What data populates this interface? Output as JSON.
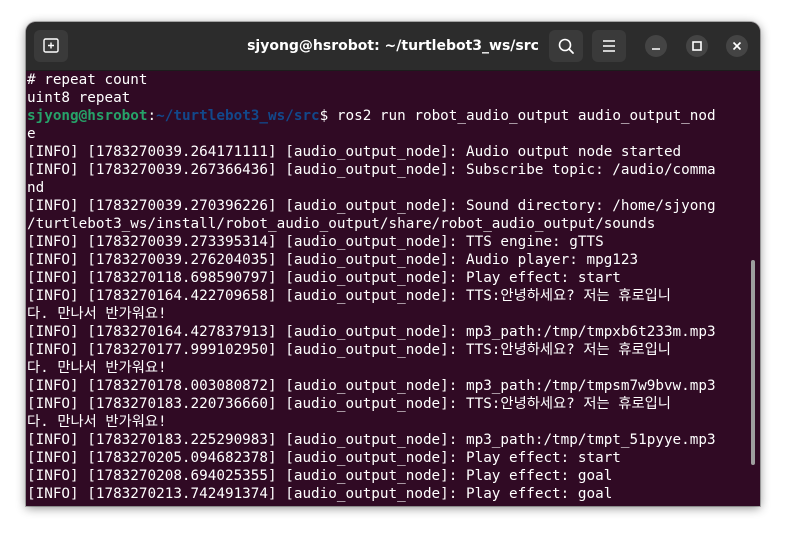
{
  "window": {
    "title": "sjyong@hsrobot: ~/turtlebot3_ws/src"
  },
  "icons": {
    "new_tab": "new-tab-icon",
    "search": "search-icon",
    "menu": "hamburger-menu-icon",
    "minimize": "minimize-icon",
    "maximize": "maximize-icon",
    "close": "close-icon"
  },
  "colors": {
    "terminal_bg": "#300a24",
    "titlebar_bg": "#2c2c2c",
    "prompt_user": "#26a269",
    "prompt_path": "#12488b",
    "text": "#ffffff"
  },
  "terminal": {
    "lines": [
      {
        "text": "# repeat count"
      },
      {
        "text": "uint8 repeat"
      },
      {
        "prompt_user": "sjyong@hsrobot",
        "prompt_colon": ":",
        "prompt_path": "~/turtlebot3_ws/src",
        "text": "$ ros2 run robot_audio_output audio_output_nod"
      },
      {
        "text": "e"
      },
      {
        "text": "[INFO] [1783270039.264171111] [audio_output_node]: Audio output node started"
      },
      {
        "text": "[INFO] [1783270039.267366436] [audio_output_node]: Subscribe topic: /audio/comma"
      },
      {
        "text": "nd"
      },
      {
        "text": "[INFO] [1783270039.270396226] [audio_output_node]: Sound directory: /home/sjyong"
      },
      {
        "text": "/turtlebot3_ws/install/robot_audio_output/share/robot_audio_output/sounds"
      },
      {
        "text": "[INFO] [1783270039.273395314] [audio_output_node]: TTS engine: gTTS"
      },
      {
        "text": "[INFO] [1783270039.276204035] [audio_output_node]: Audio player: mpg123"
      },
      {
        "text": "[INFO] [1783270118.698590797] [audio_output_node]: Play effect: start"
      },
      {
        "text": "[INFO] [1783270164.422709658] [audio_output_node]: TTS:안녕하세요? 저는 휴로입니"
      },
      {
        "text": "다. 만나서 반가워요!"
      },
      {
        "text": "[INFO] [1783270164.427837913] [audio_output_node]: mp3_path:/tmp/tmpxb6t233m.mp3"
      },
      {
        "text": "[INFO] [1783270177.999102950] [audio_output_node]: TTS:안녕하세요? 저는 휴로입니"
      },
      {
        "text": "다. 만나서 반가워요!"
      },
      {
        "text": "[INFO] [1783270178.003080872] [audio_output_node]: mp3_path:/tmp/tmpsm7w9bvw.mp3"
      },
      {
        "text": "[INFO] [1783270183.220736660] [audio_output_node]: TTS:안녕하세요? 저는 휴로입니"
      },
      {
        "text": "다. 만나서 반가워요!"
      },
      {
        "text": "[INFO] [1783270183.225290983] [audio_output_node]: mp3_path:/tmp/tmpt_51pyye.mp3"
      },
      {
        "text": "[INFO] [1783270205.094682378] [audio_output_node]: Play effect: start"
      },
      {
        "text": "[INFO] [1783270208.694025355] [audio_output_node]: Play effect: goal"
      },
      {
        "text": "[INFO] [1783270213.742491374] [audio_output_node]: Play effect: goal"
      }
    ]
  }
}
